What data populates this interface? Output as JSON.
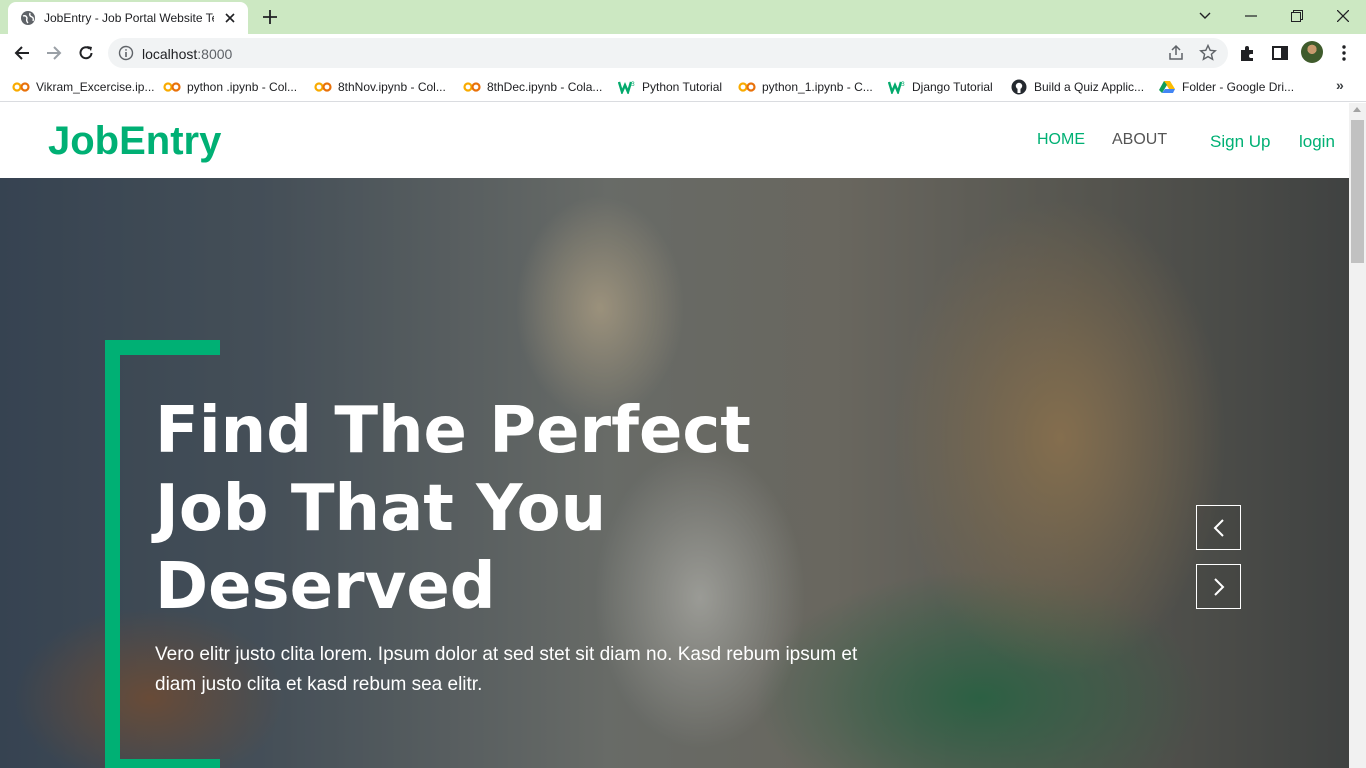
{
  "browser": {
    "tab_title": "JobEntry - Job Portal Website Template",
    "url_host": "localhost",
    "url_port": ":8000",
    "bookmarks": [
      {
        "label": "Vikram_Excercise.ip...",
        "icon": "colab-icon"
      },
      {
        "label": "python .ipynb - Col...",
        "icon": "colab-icon"
      },
      {
        "label": "8thNov.ipynb - Col...",
        "icon": "colab-icon"
      },
      {
        "label": "8thDec.ipynb - Cola...",
        "icon": "colab-icon"
      },
      {
        "label": "Python Tutorial",
        "icon": "w3schools-icon"
      },
      {
        "label": "python_1.ipynb - C...",
        "icon": "colab-icon"
      },
      {
        "label": "Django Tutorial",
        "icon": "w3schools-icon"
      },
      {
        "label": "Build a Quiz Applic...",
        "icon": "github-icon"
      },
      {
        "label": "Folder - Google Dri...",
        "icon": "drive-icon"
      }
    ],
    "more_bookmarks": "»"
  },
  "site": {
    "brand": "JobEntry",
    "nav": {
      "home": "HOME",
      "about": "ABOUT",
      "signup": "Sign Up",
      "login": "login"
    },
    "hero": {
      "title_line1": "Find The Perfect",
      "title_line2": "Job That You",
      "title_line3": "Deserved",
      "text": "Vero elitr justo clita lorem. Ipsum dolor at sed stet sit diam no. Kasd rebum ipsum et diam justo clita et kasd rebum sea elitr."
    }
  },
  "colors": {
    "accent": "#00b074",
    "titlebar": "#cce8c2",
    "nav_text": "#555555"
  }
}
